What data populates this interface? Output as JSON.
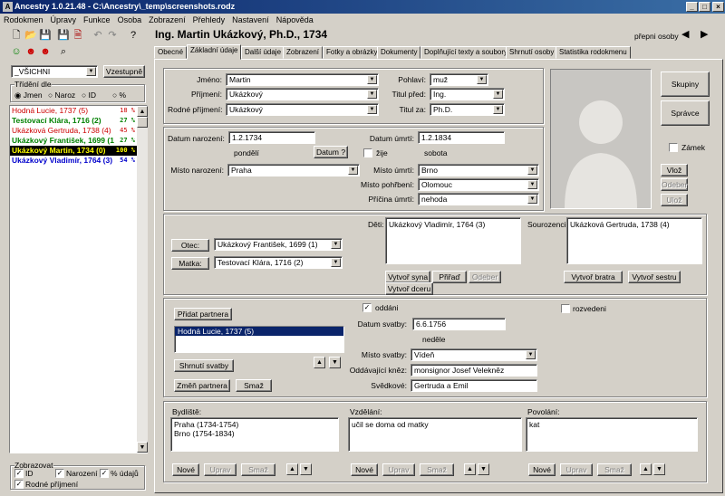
{
  "window": {
    "title": "Ancestry 1.0.21.48 - C:\\Ancestry\\_temp\\screenshots.rodz"
  },
  "menu": [
    "Rodokmen",
    "Úpravy",
    "Funkce",
    "Osoba",
    "Zobrazení",
    "Přehledy",
    "Nastavení",
    "Nápověda"
  ],
  "left": {
    "filter_value": "_VŠICHNI",
    "sort_button": "Vzestupně",
    "sort_group": "Třídění dle",
    "sort_options": [
      "Jmen",
      "Naroz",
      "ID",
      "%"
    ],
    "persons": [
      {
        "name": "Hodná Lucie, 1737 (5)",
        "pct": "18 %",
        "color": "#cc0000",
        "bold": false,
        "selected": false
      },
      {
        "name": "Testovací Klára, 1716 (2)",
        "pct": "27 %",
        "color": "#008000",
        "bold": true,
        "selected": false
      },
      {
        "name": "Ukázková Gertruda, 1738 (4)",
        "pct": "45 %",
        "color": "#cc0000",
        "bold": false,
        "selected": false
      },
      {
        "name": "Ukázkový František, 1699 (1",
        "pct": "27 %",
        "color": "#008000",
        "bold": true,
        "selected": false
      },
      {
        "name": "Ukázkový Martin, 1734 (0)",
        "pct": "100 %",
        "color": "#ffff00",
        "bold": true,
        "selected": true
      },
      {
        "name": "Ukázkový Vladimír, 1764 (3)",
        "pct": "54 %",
        "color": "#0000cc",
        "bold": true,
        "selected": false
      }
    ],
    "display_group": "Zobrazovat",
    "display_id": "ID",
    "display_birth": "Narození",
    "display_pct": "% údajů",
    "display_birthname": "Rodné příjmení"
  },
  "header": {
    "person_title": "Ing. Martin Ukázkový, Ph.D., 1734",
    "switch_label": "přepni osoby"
  },
  "tabs": [
    "Obecné",
    "Základní údaje",
    "Další údaje",
    "Zobrazení",
    "Fotky a obrázky",
    "Dokumenty",
    "Doplňující texty a soubory",
    "Shrnutí osoby",
    "Statistika rodokmenu"
  ],
  "basic": {
    "first_name_label": "Jméno:",
    "first_name": "Martin",
    "surname_label": "Příjmení:",
    "surname": "Ukázkový",
    "birth_surname_label": "Rodné příjmení:",
    "birth_surname": "Ukázkový",
    "sex_label": "Pohlaví:",
    "sex": "muž",
    "title_before_label": "Titul před:",
    "title_before": "Ing.",
    "title_after_label": "Titul za:",
    "title_after": "Ph.D."
  },
  "side_buttons": {
    "groups": "Skupiny",
    "admin": "Správce",
    "lock": "Zámek",
    "insert": "Vlož",
    "remove": "Odeber",
    "save": "Ulož"
  },
  "dates": {
    "birth_label": "Datum narození:",
    "birth": "1.2.1734",
    "birth_day": "pondělí",
    "date_button": "Datum ?",
    "alive_label": "žije",
    "death_label": "Datum úmrtí:",
    "death": "1.2.1834",
    "death_day": "sobota",
    "birth_place_label": "Místo narození:",
    "birth_place": "Praha",
    "death_place_label": "Místo úmrtí:",
    "death_place": "Brno",
    "burial_place_label": "Místo pohřbení:",
    "burial_place": "Olomouc",
    "death_cause_label": "Příčina úmrtí:",
    "death_cause": "nehoda"
  },
  "family": {
    "father_button": "Otec:",
    "father": "Ukázkový František, 1699 (1)",
    "mother_button": "Matka:",
    "mother": "Testovací Klára, 1716 (2)",
    "children_label": "Děti:",
    "children": [
      "Ukázkový Vladimír, 1764 (3)"
    ],
    "create_son": "Vytvoř syna",
    "assign": "Přiřaď",
    "remove": "Odeber",
    "create_daughter": "Vytvoř dceru",
    "siblings_label": "Sourozenci:",
    "siblings": [
      "Ukázková Gertruda, 1738 (4)"
    ],
    "create_brother": "Vytvoř bratra",
    "create_sister": "Vytvoř sestru"
  },
  "marriage": {
    "add_partner": "Přidat partnera",
    "partners": [
      "Hodná Lucie, 1737 (5)"
    ],
    "summary_button": "Shrnutí svatby",
    "change_partner": "Změň partnera",
    "delete": "Smaž",
    "married_label": "oddáni",
    "divorced_label": "rozvedeni",
    "wedding_date_label": "Datum svatby:",
    "wedding_date": "6.6.1756",
    "wedding_day": "neděle",
    "wedding_place_label": "Místo svatby:",
    "wedding_place": "Vídeň",
    "priest_label": "Oddávající kněz:",
    "priest": "monsignor Josef Velekněz",
    "witnesses_label": "Svědkové:",
    "witnesses": "Gertruda a Emil"
  },
  "bottom": {
    "residence_label": "Bydliště:",
    "residence": [
      "Praha (1734-1754)",
      "Brno (1754-1834)"
    ],
    "education_label": "Vzdělání:",
    "education": [
      "učil se doma od matky"
    ],
    "occupation_label": "Povolání:",
    "occupation": [
      "kat"
    ],
    "new": "Nové",
    "edit": "Uprav",
    "delete": "Smaž"
  }
}
